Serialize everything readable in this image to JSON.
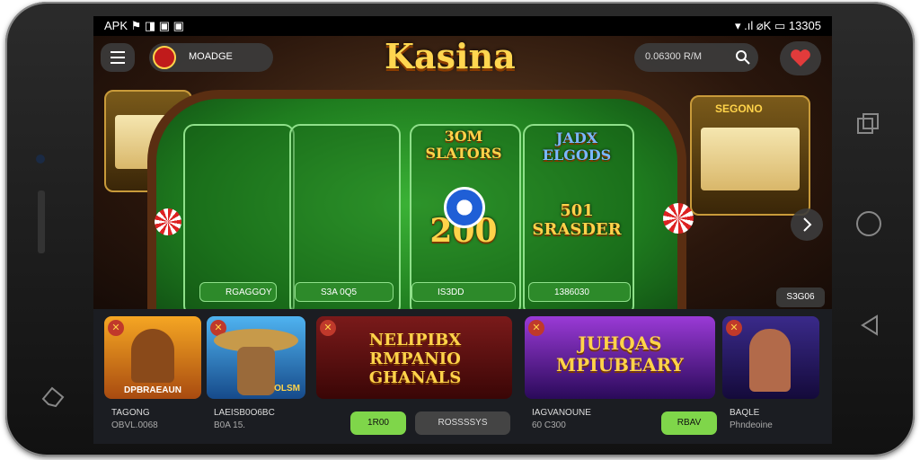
{
  "statusbar": {
    "left": "APK  ⚑  ◨  ▣  ▣",
    "right": "▾ .ıl  ⌀K  ▭  13305"
  },
  "header": {
    "user_label": "MOADGE",
    "logo": "Kasina",
    "search_value": "0.06300  R/M"
  },
  "table": {
    "panels": [
      {
        "big": "",
        "pill": "RGAGGOY"
      },
      {
        "big": "",
        "pill": "S3A 0Q5"
      },
      {
        "big": "3OM SLATORS",
        "value": "200",
        "pill": "IS3DD"
      },
      {
        "big": "JADX ELGODS",
        "value2": "501 SRASDER",
        "pill": "1386030"
      }
    ],
    "slot_sign": "SEGONO"
  },
  "side_label": "S3G06",
  "games": [
    {
      "art": "DPBRAEAUN",
      "title": "TAGONG",
      "sub": "OBVL.0068"
    },
    {
      "art": "OLSM",
      "title": "LAEISB0O6BC",
      "sub": "B0A 15."
    },
    {
      "art": "NELIPIBX RMPANIO GHANALS",
      "title": "",
      "sub": ""
    },
    {
      "art": "JUHQAS MPIUBEARY",
      "title": "IAGVANOUNE",
      "sub": "60 C300"
    },
    {
      "art": "",
      "title": "BAQLE",
      "sub": "Phndeoine"
    }
  ],
  "bottom_buttons": {
    "left": "1R00",
    "middle": "ROSSSSYS",
    "right": "RBAV"
  },
  "colors": {
    "felt": "#2f9a2b",
    "gold": "#ffd34a",
    "wood": "#5a2e12"
  }
}
